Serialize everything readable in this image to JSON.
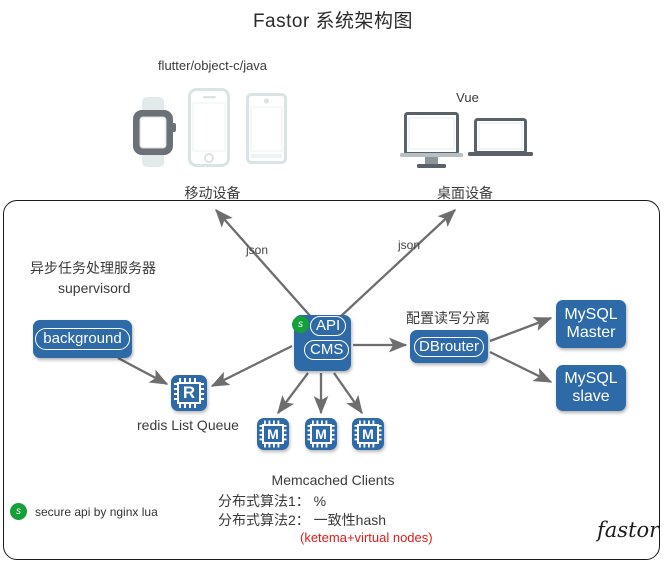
{
  "title": "Fastor 系统架构图",
  "top": {
    "mobile_tech": "flutter/object-c/java",
    "mobile_label": "移动设备",
    "desktop_tech": "Vue",
    "desktop_label": "桌面设备",
    "devices": [
      {
        "name": "smartwatch",
        "group": "mobile"
      },
      {
        "name": "iphone",
        "group": "mobile"
      },
      {
        "name": "android-phone",
        "group": "mobile"
      },
      {
        "name": "desktop-monitor",
        "group": "desktop"
      },
      {
        "name": "laptop",
        "group": "desktop"
      }
    ]
  },
  "edges": {
    "json_left": "json",
    "json_right": "json"
  },
  "async": {
    "title_cn": "异步任务处理服务器",
    "title_en": "supervisord",
    "node_label": "background"
  },
  "core": {
    "badge": "s",
    "api_label": "API",
    "cms_label": "CMS"
  },
  "redis": {
    "icon_letter": "R",
    "label": "redis List Queue"
  },
  "db": {
    "section_title": "配置读写分离",
    "router_label": "DBrouter",
    "master_line1": "MySQL",
    "master_line2": "Master",
    "slave_line1": "MySQL",
    "slave_line2": "slave"
  },
  "memcached": {
    "icon_letter": "M",
    "count": 3,
    "title": "Memcached  Clients",
    "algo1": "分布式算法1：  %",
    "algo2": "分布式算法2：  一致性hash",
    "note": "(ketema+virtual nodes)"
  },
  "legend": {
    "badge": "s",
    "text": "secure api  by nginx lua"
  },
  "signature": "fastor",
  "colors": {
    "node_blue": "#2f6aa8",
    "badge_green": "#15a03a",
    "note_red": "#e01b1b",
    "arrow_gray": "#6e6e6e",
    "device_gray": "#5a6168",
    "device_light": "#e3eaea",
    "border_black": "#1a1a1a"
  }
}
